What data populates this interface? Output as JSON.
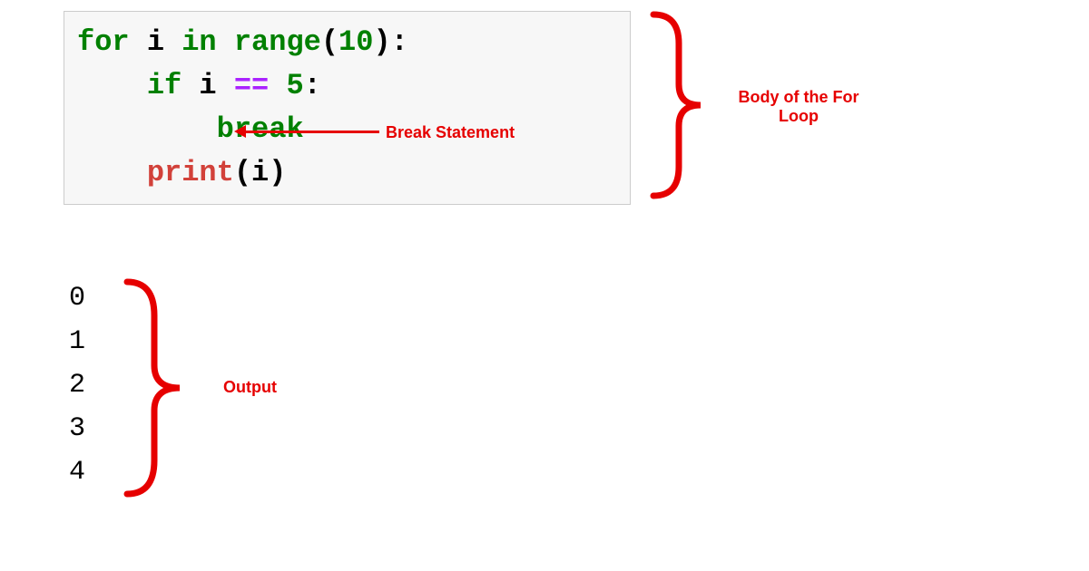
{
  "code": {
    "line1": {
      "for": "for",
      "var": "i",
      "in": "in",
      "range": "range",
      "lparen": "(",
      "num": "10",
      "rparen": ")",
      "colon": ":"
    },
    "line2": {
      "indent": "    ",
      "if": "if",
      "var": "i",
      "eq": "==",
      "num": "5",
      "colon": ":"
    },
    "line3": {
      "indent": "        ",
      "break": "break"
    },
    "line4": {
      "indent": "    ",
      "print": "print",
      "lparen": "(",
      "var": "i",
      "rparen": ")"
    }
  },
  "output": [
    "0",
    "1",
    "2",
    "3",
    "4"
  ],
  "annotations": {
    "break_label": "Break Statement",
    "body_label": "Body of the For Loop",
    "output_label": "Output"
  }
}
